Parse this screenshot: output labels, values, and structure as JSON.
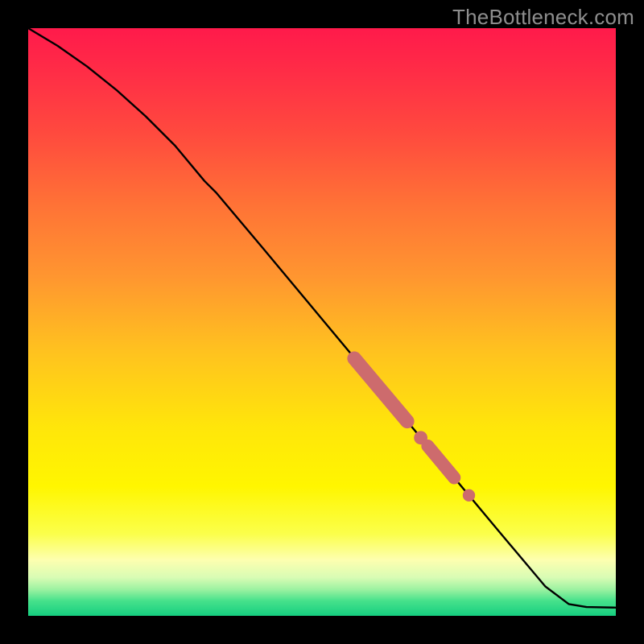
{
  "watermark": "TheBottleneck.com",
  "colors": {
    "black": "#000000",
    "line": "#000000",
    "marker": "#cd6b6d",
    "gradient_stops": [
      {
        "offset": 0.0,
        "color": "#ff1a4b"
      },
      {
        "offset": 0.08,
        "color": "#ff2e46"
      },
      {
        "offset": 0.18,
        "color": "#ff4a3e"
      },
      {
        "offset": 0.3,
        "color": "#ff7236"
      },
      {
        "offset": 0.42,
        "color": "#ff9530"
      },
      {
        "offset": 0.55,
        "color": "#ffc21f"
      },
      {
        "offset": 0.68,
        "color": "#ffe60a"
      },
      {
        "offset": 0.78,
        "color": "#fff600"
      },
      {
        "offset": 0.86,
        "color": "#fbff4a"
      },
      {
        "offset": 0.905,
        "color": "#fdffb0"
      },
      {
        "offset": 0.935,
        "color": "#d8fcb4"
      },
      {
        "offset": 0.955,
        "color": "#9cf2a1"
      },
      {
        "offset": 0.975,
        "color": "#45e18b"
      },
      {
        "offset": 1.0,
        "color": "#16cf80"
      }
    ]
  },
  "chart_data": {
    "type": "line",
    "title": "",
    "xlabel": "",
    "ylabel": "",
    "xlim": [
      0,
      100
    ],
    "ylim": [
      0,
      100
    ],
    "series": [
      {
        "name": "curve",
        "x": [
          0,
          5,
          10,
          15,
          20,
          25,
          30,
          32,
          40,
          50,
          60,
          70,
          80,
          88,
          92,
          95,
          100
        ],
        "y": [
          100,
          97,
          93.5,
          89.5,
          85,
          80,
          74,
          72,
          62.5,
          50.5,
          38.5,
          26.5,
          14.5,
          5,
          2,
          1.5,
          1.4
        ]
      }
    ],
    "markers": [
      {
        "shape": "bar",
        "x0": 55.5,
        "y0": 43.8,
        "x1": 64.5,
        "y1": 33.1,
        "thickness": 2.4
      },
      {
        "shape": "round",
        "cx": 66.8,
        "cy": 30.3,
        "r": 1.15
      },
      {
        "shape": "bar",
        "x0": 68.0,
        "y0": 28.9,
        "x1": 72.5,
        "y1": 23.5,
        "thickness": 2.2
      },
      {
        "shape": "round",
        "cx": 75.0,
        "cy": 20.5,
        "r": 1.05
      }
    ]
  }
}
